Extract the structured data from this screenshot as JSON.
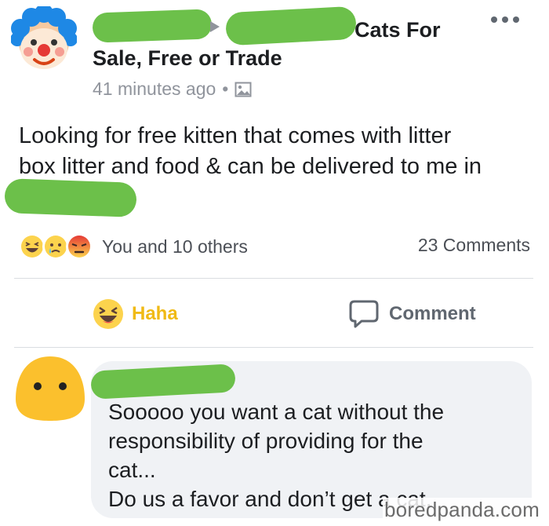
{
  "post": {
    "author_avatar_icon": "clown-face-icon",
    "group_name_line1": "Cats For",
    "group_name_line2": "Sale, Free or Trade",
    "timestamp": "41 minutes ago",
    "timestamp_separator": "•",
    "audience_icon": "image-icon",
    "more_icon": "more-dots-icon",
    "body_line1": "Looking for free kitten that comes with litter",
    "body_line2": "box litter and food & can be delivered to me in"
  },
  "reactions": {
    "icons": [
      "haha-emoji-icon",
      "sad-emoji-icon",
      "angry-emoji-icon"
    ],
    "summary": "You and 10 others",
    "comments": "23 Comments"
  },
  "actions": {
    "haha_label": "Haha",
    "comment_label": "Comment"
  },
  "comment": {
    "avatar_icon": "blob-face-icon",
    "lines": [
      "Sooooo you want a cat without the",
      "responsibility of providing for the",
      "cat...",
      "Do us a favor and don’t get a cat."
    ]
  },
  "watermark": "boredpanda.com",
  "colors": {
    "redaction": "#6cc04a",
    "haha_accent": "#f0ba15",
    "muted_text": "#90949c",
    "bubble_bg": "#f0f2f5"
  }
}
